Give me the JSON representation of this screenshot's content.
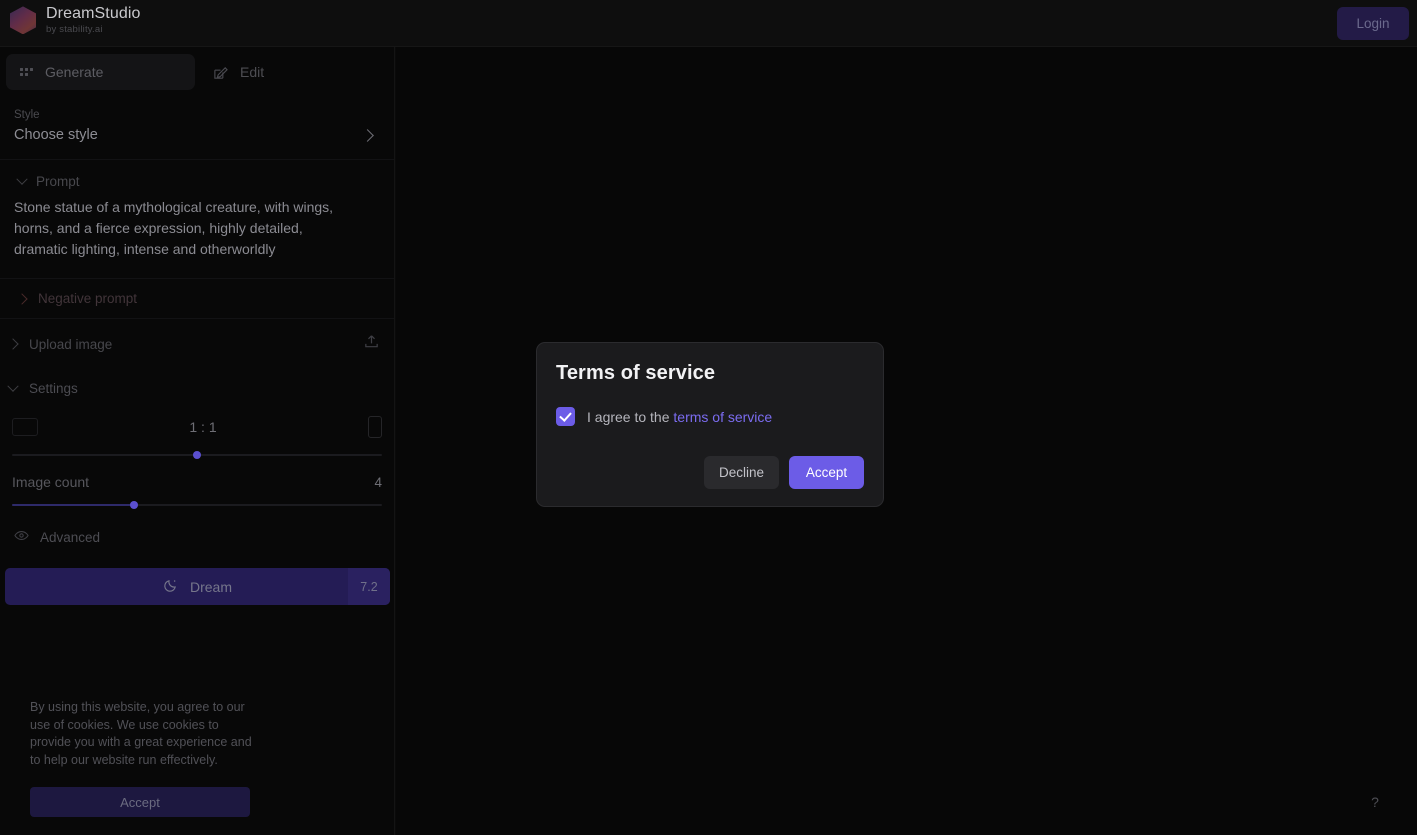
{
  "header": {
    "brand_title": "DreamStudio",
    "brand_subtitle": "by stability.ai",
    "logo_icon": "hexagon-gradient-logo",
    "login_label": "Login"
  },
  "sidebar": {
    "tabs": [
      {
        "label": "Generate",
        "icon": "grid-icon",
        "active": true
      },
      {
        "label": "Edit",
        "icon": "pencil-square-icon",
        "active": false
      }
    ],
    "style": {
      "section_label": "Style",
      "value": "Choose style",
      "chevron_icon": "chevron-right-icon"
    },
    "prompt": {
      "title": "Prompt",
      "chevron_icon": "chevron-down-icon",
      "text": "Stone statue of a mythological creature, with wings, horns, and a fierce expression, highly detailed, dramatic lighting, intense and otherworldly"
    },
    "negative_prompt": {
      "title": "Negative prompt",
      "chevron_icon": "chevron-right-icon"
    },
    "upload_image": {
      "title": "Upload image",
      "chevron_icon": "chevron-right-icon",
      "action_icon": "upload-icon"
    },
    "settings": {
      "title": "Settings",
      "chevron_icon": "chevron-down-icon",
      "aspect_ratio": {
        "value": "1 : 1",
        "left_icon": "landscape-icon",
        "right_icon": "portrait-icon",
        "slider_percent": 50
      },
      "image_count": {
        "label": "Image count",
        "value": "4",
        "slider_percent": 33
      }
    },
    "advanced": {
      "label": "Advanced",
      "icon": "eye-icon"
    },
    "dream_button": {
      "label": "Dream",
      "icon": "moon-icon",
      "credits": "7.2"
    },
    "cookie_notice": {
      "text": "By using this website, you agree to our use of cookies. We use cookies to provide you with a great experience and to help our website run effectively.",
      "accept_label": "Accept"
    }
  },
  "canvas": {
    "help_label": "?"
  },
  "modal": {
    "title": "Terms of service",
    "checkbox_checked": true,
    "agree_prefix": "I agree to the ",
    "agree_link": "terms of service",
    "decline_label": "Decline",
    "accept_label": "Accept"
  },
  "colors": {
    "accent": "#6c5ce7",
    "accent_link": "#7b6cf0",
    "dream_bg": "#241c55",
    "app_bg": "#0a0a0a"
  }
}
